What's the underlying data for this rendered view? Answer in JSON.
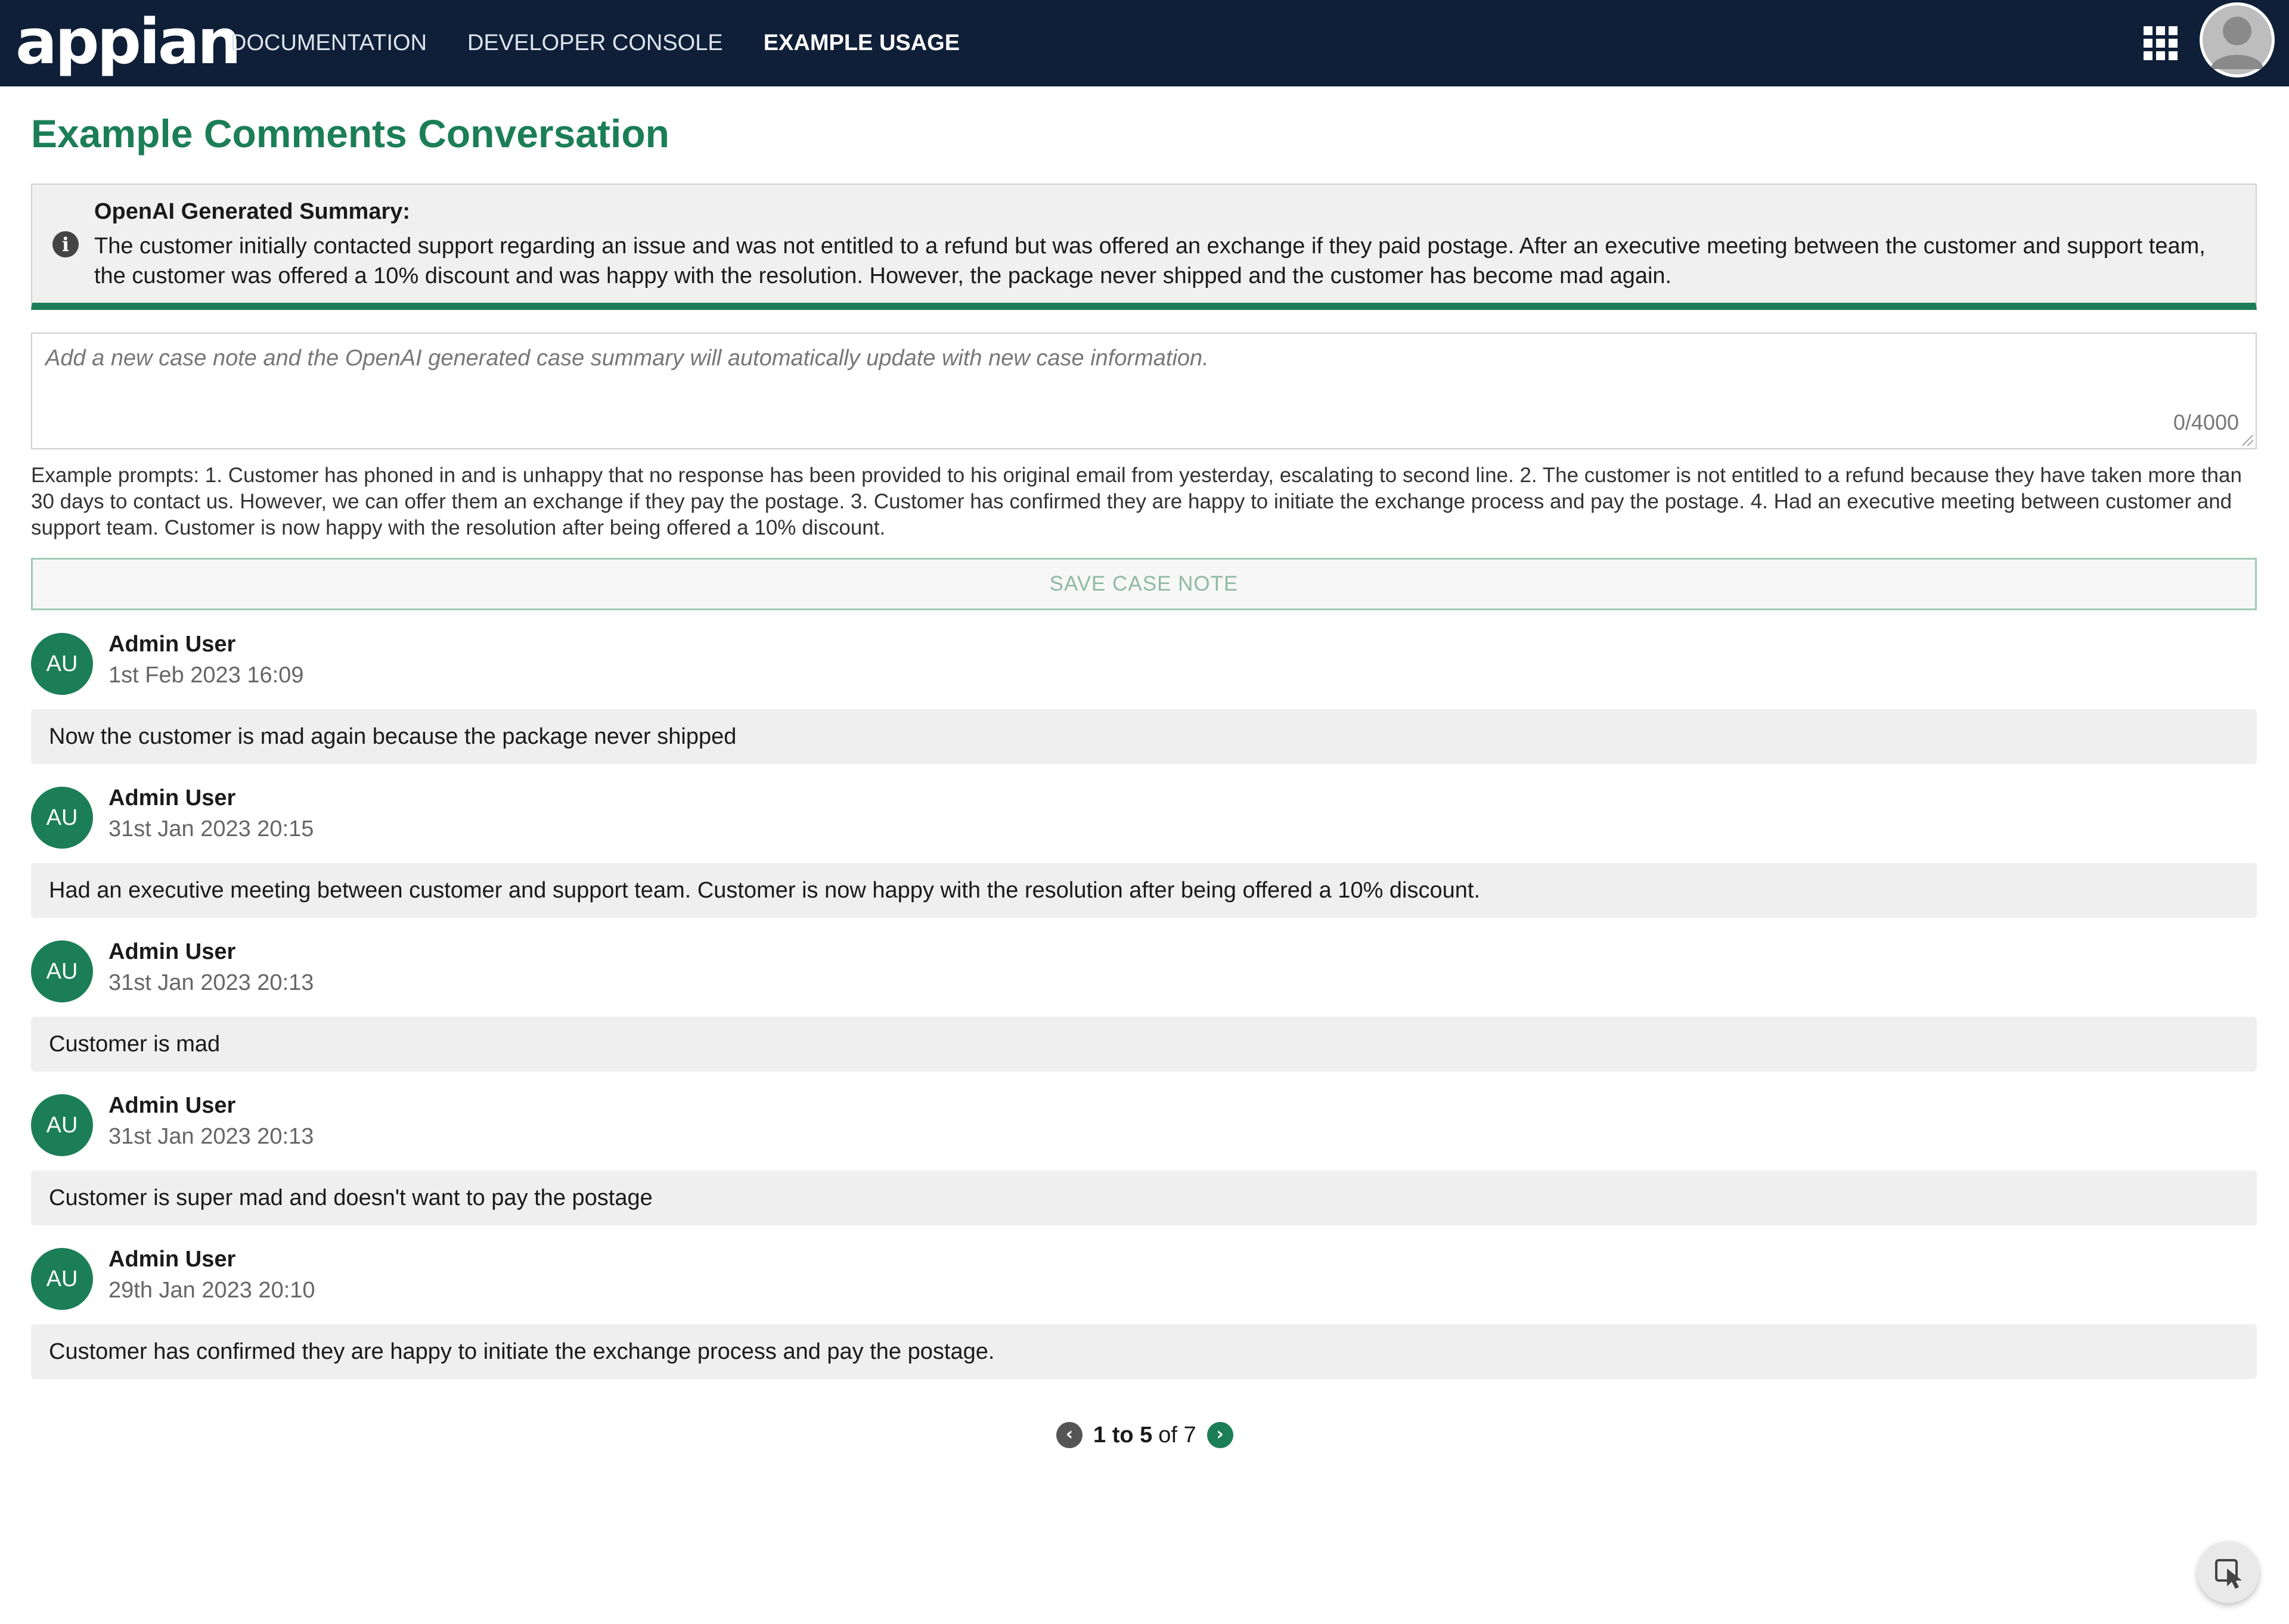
{
  "header": {
    "logo_text": "appian",
    "nav": [
      {
        "label": "DOCUMENTATION"
      },
      {
        "label": "DEVELOPER CONSOLE"
      },
      {
        "label": "EXAMPLE USAGE",
        "active": true
      }
    ],
    "apps_icon": "grid-icon",
    "user_icon": "user-avatar-icon"
  },
  "page": {
    "title": "Example Comments Conversation"
  },
  "summary": {
    "icon": "info-icon",
    "title": "OpenAI Generated Summary:",
    "text": "The customer initially contacted support regarding an issue and was not entitled to a refund but was offered an exchange if they paid postage. After an executive meeting between the customer and support team, the customer was offered a 10% discount and was happy with the resolution. However, the package never shipped and the customer has become mad again."
  },
  "note": {
    "value": "",
    "placeholder": "Add a new case note and the OpenAI generated case summary will automatically update with new case information.",
    "counter": "0/4000"
  },
  "prompts_text": "Example prompts: 1. Customer has phoned in and is unhappy that no response has been provided to his original email from yesterday, escalating to second line. 2. The customer is not entitled to a refund because they have taken more than 30 days to contact us. However, we can offer them an exchange if they pay the postage. 3. Customer has confirmed they are happy to initiate the exchange process and pay the postage. 4. Had an executive meeting between customer and support team. Customer is now happy with the resolution after being offered a 10% discount.",
  "save_button": {
    "label": "SAVE CASE NOTE"
  },
  "comments": [
    {
      "initials": "AU",
      "author": "Admin User",
      "date": "1st Feb 2023 16:09",
      "text": "Now the customer is mad again because the package never shipped"
    },
    {
      "initials": "AU",
      "author": "Admin User",
      "date": "31st Jan 2023 20:15",
      "text": "Had an executive meeting between customer and support team. Customer is now happy with the resolution after being offered a 10% discount."
    },
    {
      "initials": "AU",
      "author": "Admin User",
      "date": "31st Jan 2023 20:13",
      "text": "Customer is mad"
    },
    {
      "initials": "AU",
      "author": "Admin User",
      "date": "31st Jan 2023 20:13",
      "text": "Customer is super mad and doesn't want to pay the postage"
    },
    {
      "initials": "AU",
      "author": "Admin User",
      "date": "29th Jan 2023 20:10",
      "text": "Customer has confirmed they are happy to initiate the exchange process and pay the postage."
    }
  ],
  "pager": {
    "range": "1 to 5",
    "total": "of 7",
    "prev_icon": "chevron-left-icon",
    "next_icon": "chevron-right-icon"
  },
  "fab": {
    "icon": "cursor-select-icon"
  },
  "colors": {
    "nav_bg": "#0f1f38",
    "accent": "#1b7e57",
    "panel_bg": "#f0f0f0"
  }
}
